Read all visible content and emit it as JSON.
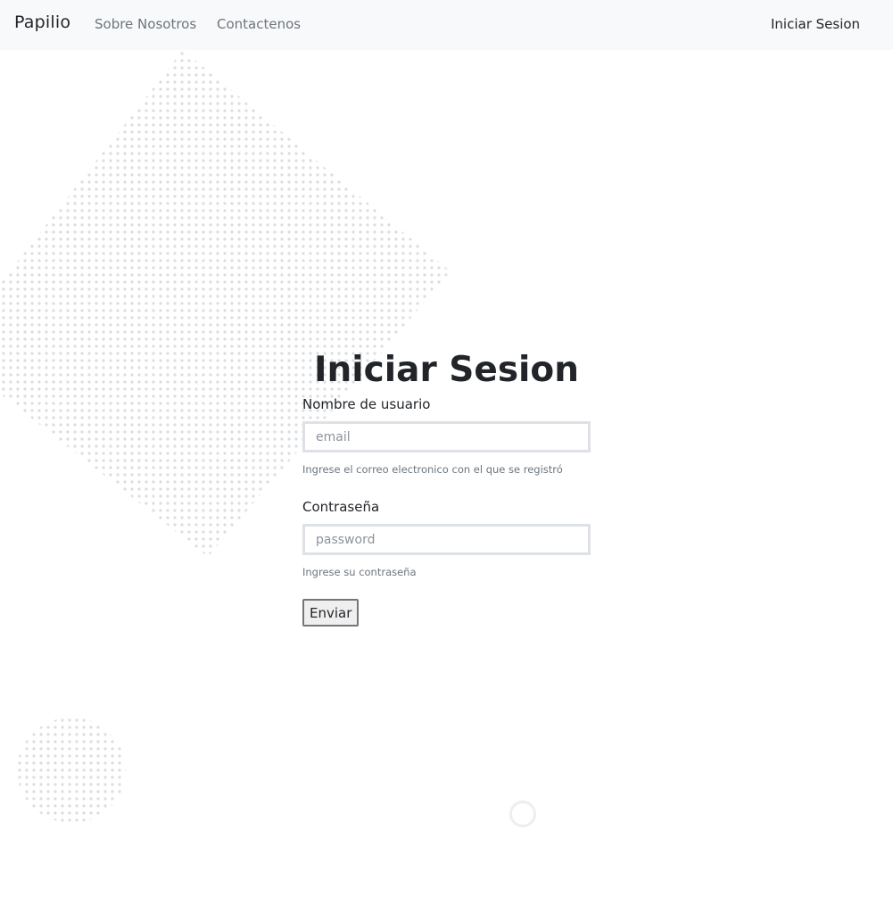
{
  "navbar": {
    "brand": "Papilio",
    "links": [
      "Sobre Nosotros",
      "Contactenos"
    ],
    "login": "Iniciar Sesion"
  },
  "page": {
    "title": "Iniciar Sesion"
  },
  "form": {
    "username_label": "Nombre de usuario",
    "username_placeholder": "email",
    "username_help": "Ingrese el correo electronico con el que se registró",
    "password_label": "Contraseña",
    "password_placeholder": "password",
    "password_help": "Ingrese su contraseña",
    "submit_label": "Enviar"
  },
  "colors": {
    "navbar_bg": "#f8f9fa",
    "muted_text": "#6c757d",
    "dot_pattern": "#dadde0"
  }
}
